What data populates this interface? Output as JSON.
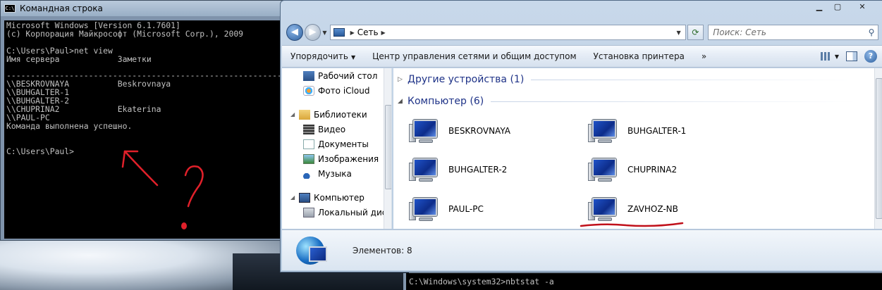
{
  "cmd": {
    "title": "Командная строка",
    "app_icon": "C:\\",
    "lines": [
      "Microsoft Windows [Version 6.1.7601]",
      "(c) Корпорация Майкрософт (Microsoft Corp.), 2009",
      "",
      "C:\\Users\\Paul>net view",
      "Имя сервера            Заметки",
      "",
      "-------------------------------------------------------------------",
      "\\\\BESKROVNAYA          Beskrovnaya",
      "\\\\BUHGALTER-1",
      "\\\\BUHGALTER-2",
      "\\\\CHUPRINA2            Ekaterina",
      "\\\\PAUL-PC",
      "Команда выполнена успешно.",
      "",
      "",
      "C:\\Users\\Paul>"
    ],
    "annotation_color": "#e0202a"
  },
  "explorer": {
    "window_controls": {
      "minimize": "▁",
      "maximize": "▢",
      "close": "✕"
    },
    "address": {
      "location": "Сеть"
    },
    "search": {
      "placeholder": "Поиск: Сеть"
    },
    "toolbar": {
      "organize": "Упорядочить",
      "network_center": "Центр управления сетями и общим доступом",
      "add_printer": "Установка принтера",
      "more": "»"
    },
    "nav": {
      "items": [
        {
          "label": "Рабочий стол",
          "icon": "desktop-icon"
        },
        {
          "label": "Фото iCloud",
          "icon": "icloud-icon"
        },
        {
          "label": "Библиотеки",
          "icon": "library-icon"
        },
        {
          "label": "Видео",
          "icon": "video-icon"
        },
        {
          "label": "Документы",
          "icon": "documents-icon"
        },
        {
          "label": "Изображения",
          "icon": "images-icon"
        },
        {
          "label": "Музыка",
          "icon": "music-icon"
        },
        {
          "label": "Компьютер",
          "icon": "computer-icon"
        },
        {
          "label": "Локальный диск",
          "icon": "disk-icon"
        }
      ]
    },
    "groups": {
      "other": "Другие устройства (1)",
      "computers": "Компьютер (6)"
    },
    "computers": [
      "BESKROVNAYA",
      "BUHGALTER-1",
      "BUHGALTER-2",
      "CHUPRINA2",
      "PAUL-PC",
      "ZAVHOZ-NB"
    ],
    "status": "Элементов: 8"
  },
  "cmd2": {
    "line": "C:\\Windows\\system32>nbtstat -a"
  }
}
